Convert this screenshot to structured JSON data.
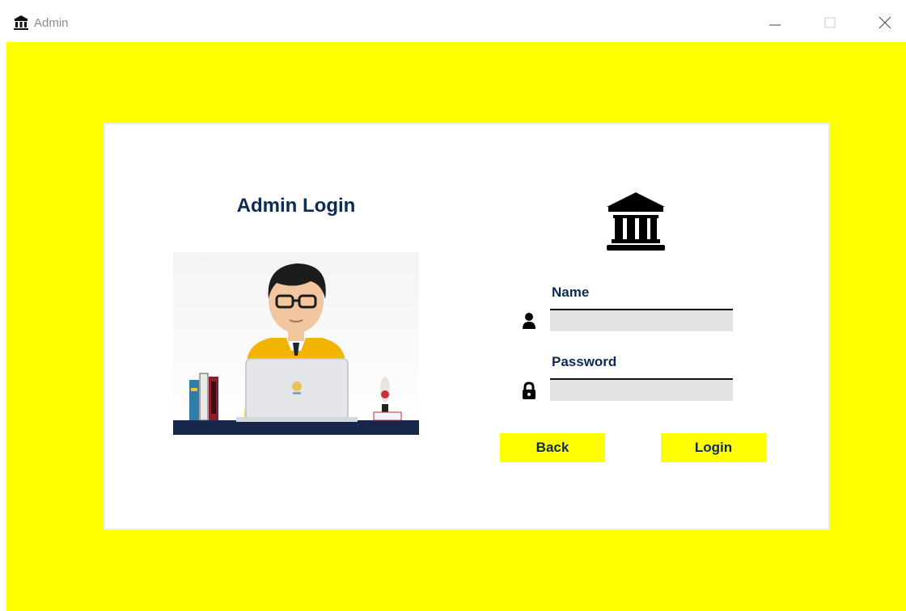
{
  "window": {
    "title": "Admin",
    "icon": "bank-icon",
    "controls": [
      "minimize-icon",
      "maximize-icon",
      "close-icon"
    ]
  },
  "colors": {
    "background": "#ffff00",
    "card": "#ffffff",
    "heading_text": "#0b2a55",
    "input_bg": "#e3e3e3"
  },
  "login": {
    "heading": "Admin Login",
    "illustration": "admin-at-laptop-illustration",
    "logo": "bank-icon",
    "name_label": "Name",
    "name_icon": "user-icon",
    "name_value": "",
    "password_label": "Password",
    "password_icon": "lock-icon",
    "password_value": "",
    "back_label": "Back",
    "login_label": "Login"
  }
}
